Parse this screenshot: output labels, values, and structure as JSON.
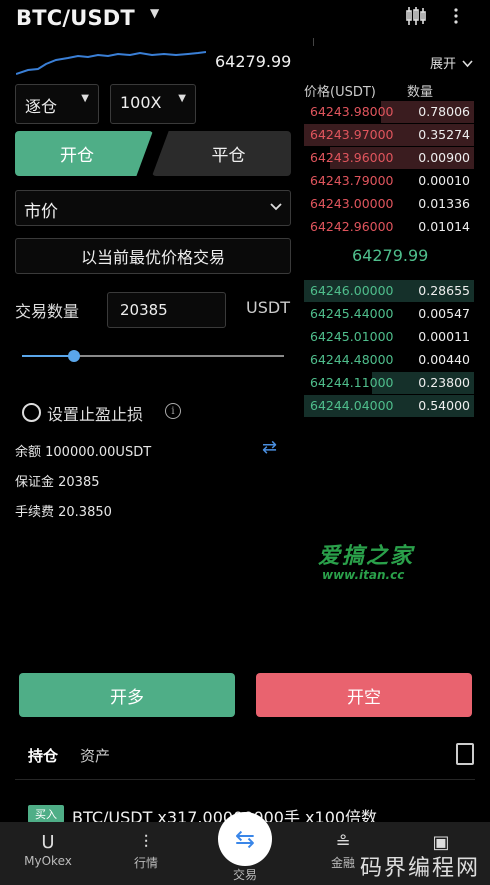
{
  "header": {
    "pair": "BTC/USDT",
    "caret": "▼"
  },
  "spark": {
    "price": "64279.99"
  },
  "margin_mode": "逐仓",
  "leverage": "100X",
  "side_tabs": {
    "open": "开仓",
    "close": "平仓"
  },
  "order_type": "市价",
  "best_price_label": "以当前最优价格交易",
  "quantity": {
    "label": "交易数量",
    "value": "20385",
    "unit": "USDT"
  },
  "slider": {
    "fraction": 0.2
  },
  "tp_sl_label": "设置止盈止损",
  "info_glyph": "i",
  "account": {
    "balance": "余额 100000.00USDT",
    "margin": "保证金 20385",
    "fee": "手续费 20.3850"
  },
  "orderbook": {
    "expand_label": "展开",
    "price_header": "价格(USDT)",
    "qty_header": "数量",
    "asks": [
      {
        "price": "64243.98000",
        "qty": "0.78006",
        "depth": 0.55
      },
      {
        "price": "64243.97000",
        "qty": "0.35274",
        "depth": 1.0
      },
      {
        "price": "64243.96000",
        "qty": "0.00900",
        "depth": 0.85
      },
      {
        "price": "64243.79000",
        "qty": "0.00010",
        "depth": 0.0
      },
      {
        "price": "64243.00000",
        "qty": "0.01336",
        "depth": 0.0
      },
      {
        "price": "64242.96000",
        "qty": "0.01014",
        "depth": 0.0
      }
    ],
    "mid_price": "64279.99",
    "bids": [
      {
        "price": "64246.00000",
        "qty": "0.28655",
        "depth": 1.0
      },
      {
        "price": "64245.44000",
        "qty": "0.00547",
        "depth": 0.0
      },
      {
        "price": "64245.01000",
        "qty": "0.00011",
        "depth": 0.0
      },
      {
        "price": "64244.48000",
        "qty": "0.00440",
        "depth": 0.0
      },
      {
        "price": "64244.11000",
        "qty": "0.23800",
        "depth": 0.6
      },
      {
        "price": "64244.04000",
        "qty": "0.54000",
        "depth": 1.0
      }
    ]
  },
  "watermark": {
    "line1": "爱搞之家",
    "line2": "www.itan.cc"
  },
  "actions": {
    "long": "开多",
    "short": "开空"
  },
  "bottom_tabs": {
    "positions": "持仓",
    "assets": "资产"
  },
  "position": {
    "badge": "买入",
    "text": "BTC/USDT x317.00000000手 x100倍数"
  },
  "nav": [
    {
      "label": "MyOkex",
      "icon": "U"
    },
    {
      "label": "行情",
      "icon": "⫶"
    },
    {
      "label": "交易",
      "icon": "⇆"
    },
    {
      "label": "金融",
      "icon": "≗"
    },
    {
      "label": "",
      "icon": "▣"
    }
  ],
  "corner_watermark": "码界编程网",
  "colors": {
    "green": "#4fae87",
    "red": "#e9636f",
    "blue": "#5aa6ea"
  }
}
